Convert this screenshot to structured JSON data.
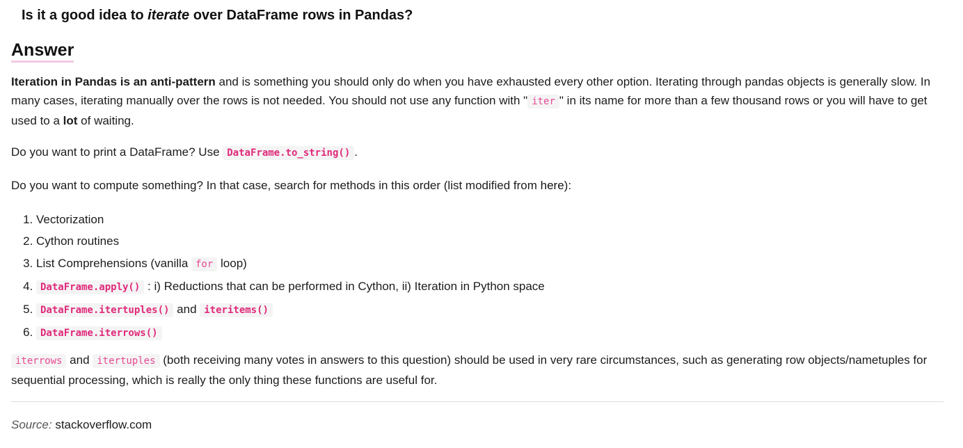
{
  "question": {
    "before": "Is it a good idea to ",
    "emph": "iterate",
    "after": " over DataFrame rows in Pandas?"
  },
  "answer_heading": "Answer",
  "p1": {
    "bold_lead": "Iteration in Pandas is an anti-pattern",
    "text_a": " and is something you should only do when you have exhausted every other option. Iterating through pandas objects is generally slow. In many cases, iterating manually over the rows is not needed. You should not use any function with \"",
    "code_iter": "iter",
    "text_b": "\" in its name for more than a few thousand rows or you will have to get used to a ",
    "bold_lot": "lot",
    "text_c": " of waiting."
  },
  "p2": {
    "text": "Do you want to print a DataFrame? Use ",
    "code": "DataFrame.to_string()",
    "end": "."
  },
  "p3": {
    "text": "Do you want to compute something? In that case, search for methods in this order (list modified from ",
    "link": "here",
    "end": "):"
  },
  "methods": [
    {
      "text": "Vectorization"
    },
    {
      "text": "Cython routines"
    },
    {
      "text_a": "List Comprehensions (vanilla ",
      "code": "for",
      "text_b": " loop)"
    },
    {
      "code": "DataFrame.apply()",
      "text_b": " : i)  Reductions that can be performed in Cython, ii) Iteration in Python space"
    },
    {
      "code": "DataFrame.itertuples()",
      "text_b": " and ",
      "code2": "iteritems()"
    },
    {
      "code": "DataFrame.iterrows()"
    }
  ],
  "p4": {
    "code1": "iterrows",
    "and": " and ",
    "code2": "itertuples",
    "text": " (both receiving many votes in answers to this question) should be used in very rare circumstances, such as generating row objects/nametuples for sequential processing, which is really the only thing these functions are useful for."
  },
  "source": {
    "label": "Source:",
    "value": " stackoverflow.com"
  },
  "colors": {
    "code_text": "#e0297a",
    "code_bg": "#f4f4f4",
    "heading_underline": "#f2c9e3"
  }
}
